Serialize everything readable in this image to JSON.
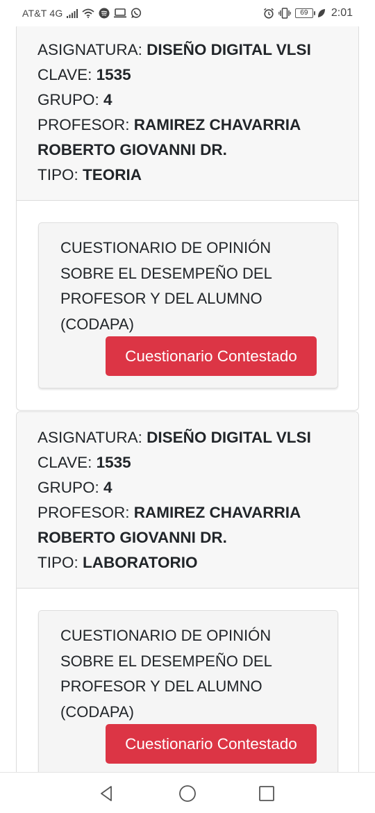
{
  "status_bar": {
    "carrier": "AT&T 4G",
    "battery": "69",
    "time": "2:01"
  },
  "courses": [
    {
      "subject_label": "ASIGNATURA:",
      "subject": "DISEÑO DIGITAL VLSI",
      "key_label": "CLAVE:",
      "key": "1535",
      "group_label": "GRUPO:",
      "group": "4",
      "professor_label": "PROFESOR:",
      "professor_line1": "RAMIREZ CHAVARRIA",
      "professor_line2": "ROBERTO GIOVANNI DR.",
      "type_label": "TIPO:",
      "type": "TEORIA",
      "survey_lines": [
        "CUESTIONARIO DE OPINIÓN",
        "SOBRE EL DESEMPEÑO DEL",
        "PROFESOR Y DEL ALUMNO",
        "(CODAPA)"
      ],
      "button_label": "Cuestionario Contestado"
    },
    {
      "subject_label": "ASIGNATURA:",
      "subject": "DISEÑO DIGITAL VLSI",
      "key_label": "CLAVE:",
      "key": "1535",
      "group_label": "GRUPO:",
      "group": "4",
      "professor_label": "PROFESOR:",
      "professor_line1": "RAMIREZ CHAVARRIA",
      "professor_line2": "ROBERTO GIOVANNI DR.",
      "type_label": "TIPO:",
      "type": "LABORATORIO",
      "survey_lines": [
        "CUESTIONARIO DE OPINIÓN",
        "SOBRE EL DESEMPEÑO DEL",
        "PROFESOR Y DEL ALUMNO",
        "(CODAPA)"
      ],
      "button_label": "Cuestionario Contestado"
    }
  ],
  "colors": {
    "button": "#dc3545",
    "header_bg": "#f7f7f7",
    "survey_bg": "#f5f5f5"
  },
  "icons": {
    "status_left": [
      "signal-icon",
      "wifi-icon",
      "spotify-icon",
      "cast-icon",
      "whatsapp-icon"
    ],
    "status_right": [
      "alarm-icon",
      "vibrate-icon",
      "battery-icon",
      "leaf-icon"
    ],
    "nav": [
      "back-icon",
      "home-icon",
      "recents-icon"
    ]
  }
}
